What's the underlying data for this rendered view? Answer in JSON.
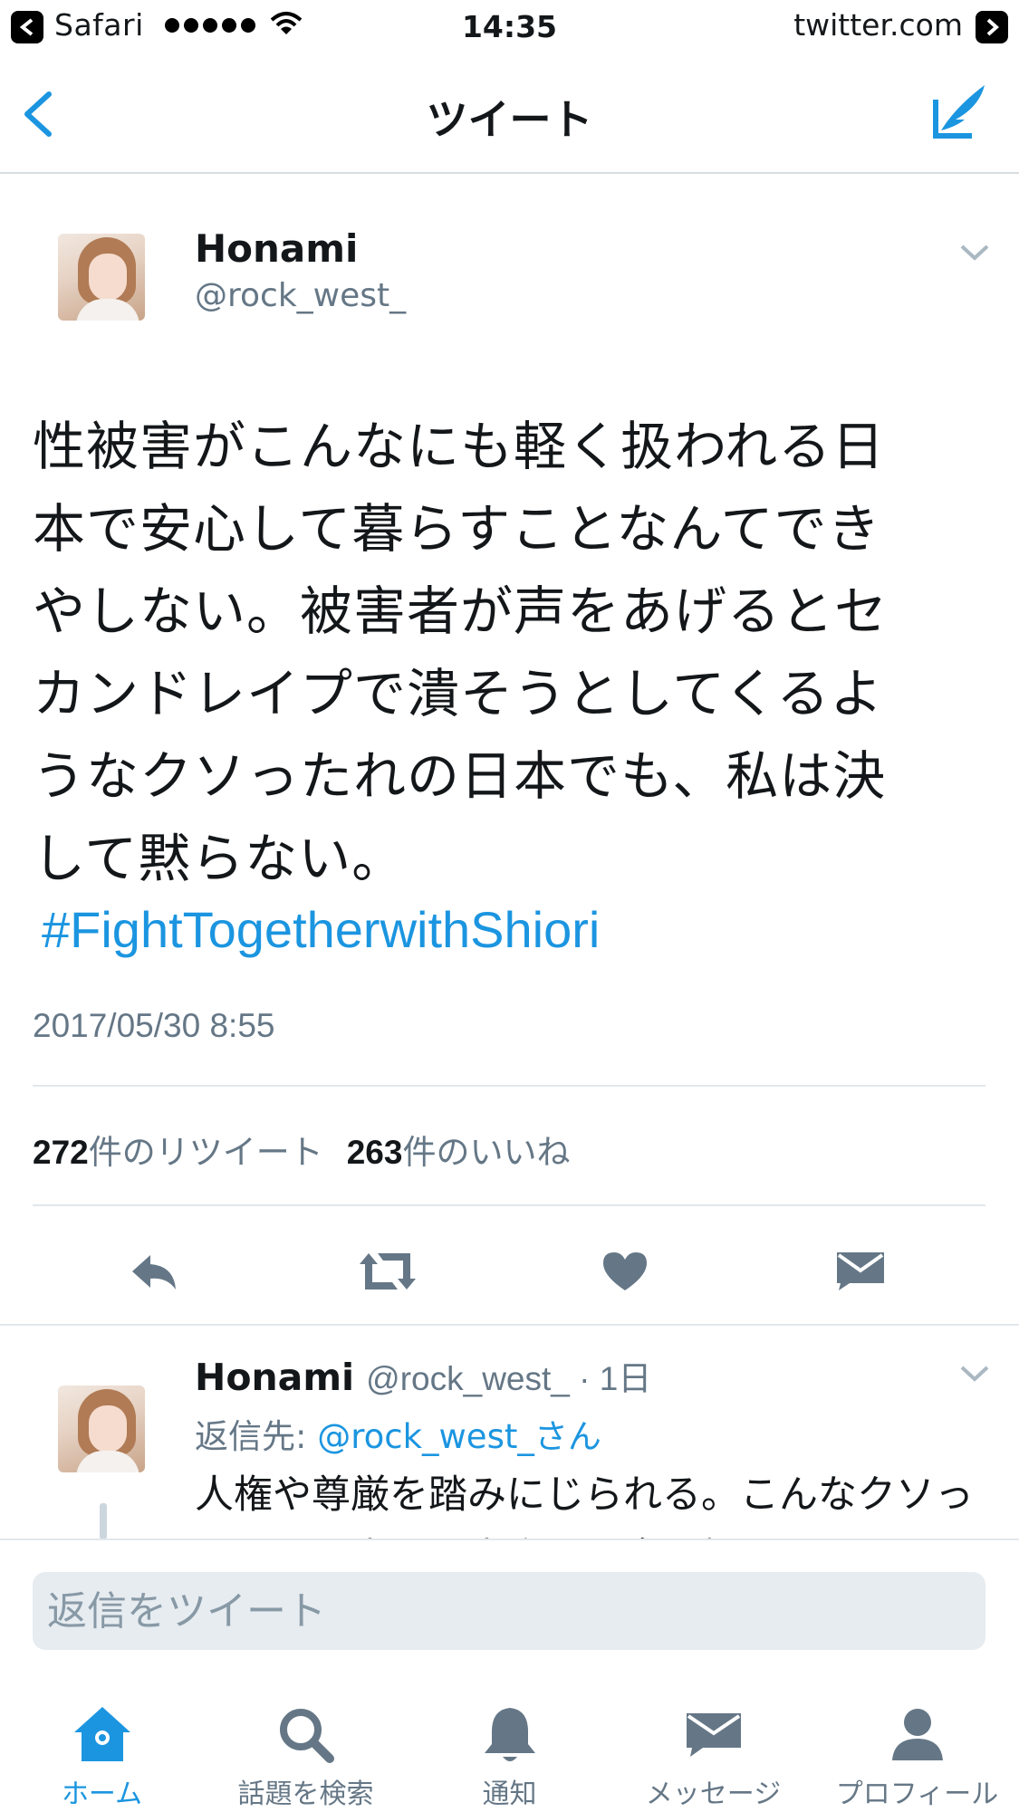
{
  "status_bar": {
    "app": "Safari",
    "time": "14:35",
    "site": "twitter.com"
  },
  "nav": {
    "title": "ツイート"
  },
  "tweet": {
    "name": "Honami",
    "handle": "@rock_west_",
    "text_lines": [
      "性被害がこんなにも軽く扱われる日",
      "本で安心して暮らすことなんてでき",
      "やしない。被害者が声をあげるとセ",
      "カンドレイプで潰そうとしてくるよ",
      "うなクソったれの日本でも、私は決",
      "して黙らない。"
    ],
    "hashtag": "#FightTogetherwithShiori",
    "timestamp": "2017/05/30 8:55",
    "retweet_count": "272",
    "retweet_label": "件のリツイート",
    "like_count": "263",
    "like_label": "件のいいね"
  },
  "reply": {
    "name": "Honami",
    "handle_time": "@rock_west_ · 1日",
    "reply_to_prefix": "返信先: ",
    "reply_to_mention": "@rock_west_さん",
    "text": "人権や尊厳を踏みにじられる。こんなクソったれな日本は、崇高な理念を掲げている"
  },
  "composer": {
    "placeholder": "返信をツイート"
  },
  "tabs": [
    {
      "label": "ホーム",
      "icon": "home-icon",
      "active": true
    },
    {
      "label": "話題を検索",
      "icon": "search-icon",
      "active": false
    },
    {
      "label": "通知",
      "icon": "bell-icon",
      "active": false
    },
    {
      "label": "メッセージ",
      "icon": "envelope-icon",
      "active": false
    },
    {
      "label": "プロフィール",
      "icon": "person-icon",
      "active": false
    }
  ],
  "colors": {
    "accent": "#1b95e0",
    "secondary_text": "#657786",
    "icon_gray": "#657786",
    "divider": "#e1e8ed"
  }
}
